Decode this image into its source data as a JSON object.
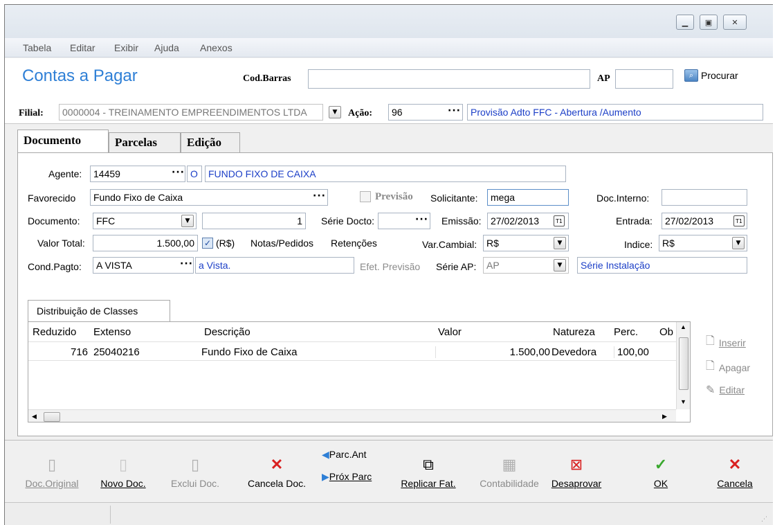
{
  "menu": [
    "Tabela",
    "Editar",
    "Exibir",
    "Ajuda",
    "Anexos"
  ],
  "header": {
    "title": "Contas a Pagar",
    "cod_barras_label": "Cod.Barras",
    "cod_barras_value": "",
    "ap_label": "AP",
    "ap_value": "",
    "procurar_label": "Procurar",
    "filial_label": "Filial:",
    "filial_value": "0000004 - TREINAMENTO EMPREENDIMENTOS LTDA",
    "acao_label": "Ação:",
    "acao_value": "96",
    "acao_desc": "Provisão Adto FFC - Abertura /Aumento"
  },
  "tabs": [
    "Documento",
    "Parcelas",
    "Edição"
  ],
  "form": {
    "agente_label": "Agente:",
    "agente_code": "14459",
    "agente_type": "O",
    "agente_name": "FUNDO FIXO DE CAIXA",
    "favorecido_label": "Favorecido",
    "favorecido_value": "Fundo Fixo de Caixa",
    "previsao_label": "Previsão",
    "solicitante_label": "Solicitante:",
    "solicitante_value": "mega",
    "doc_interno_label": "Doc.Interno:",
    "doc_interno_value": "",
    "documento_label": "Documento:",
    "documento_value": "FFC",
    "documento_num": "1",
    "serie_docto_label": "Série Docto:",
    "serie_docto_value": "",
    "emissao_label": "Emissão:",
    "emissao_value": "27/02/2013",
    "entrada_label": "Entrada:",
    "entrada_value": "27/02/2013",
    "valor_total_label": "Valor Total:",
    "valor_total_value": "1.500,00",
    "currency_check_label": "(R$)",
    "notas_label": "Notas/Pedidos",
    "retencoes_label": "Retenções",
    "var_cambial_label": "Var.Cambial:",
    "var_cambial_value": "R$",
    "indice_label": "Indice:",
    "indice_value": "R$",
    "cond_pagto_label": "Cond.Pagto:",
    "cond_pagto_value": "A VISTA",
    "cond_pagto_desc": "a Vista.",
    "efet_previsao_label": "Efet. Previsão",
    "serie_ap_label": "Série AP:",
    "serie_ap_value": "AP",
    "serie_ap_desc": "Série Instalação",
    "cal_glyph": "T1"
  },
  "distribution": {
    "tab_label": "Distribuição de Classes",
    "columns": [
      "Reduzido",
      "Extenso",
      "Descrição",
      "Valor",
      "Natureza",
      "Perc.",
      "Ob"
    ],
    "rows": [
      {
        "reduzido": "716",
        "extenso": "25040216",
        "descricao": "Fundo Fixo de Caixa",
        "valor": "1.500,00",
        "natureza": "Devedora",
        "perc": "100,00"
      }
    ],
    "side_buttons": [
      "Inserir",
      "Apagar",
      "Editar"
    ]
  },
  "toolbar": {
    "doc_original": "Doc.Original",
    "novo_doc": "Novo Doc.",
    "exclui_doc": "Exclui Doc.",
    "cancela_doc": "Cancela Doc.",
    "parc_ant": "Parc.Ant",
    "prox_parc": "Próx Parc",
    "replicar_fat": "Replicar Fat.",
    "contabilidade": "Contabilidade",
    "desaprovar": "Desaprovar",
    "ok": "OK",
    "cancela": "Cancela"
  },
  "colors": {
    "title_blue": "#2e7fd6",
    "link_blue": "#1c3fc7",
    "cancel_red": "#d92020",
    "ok_green": "#3aa82e"
  }
}
